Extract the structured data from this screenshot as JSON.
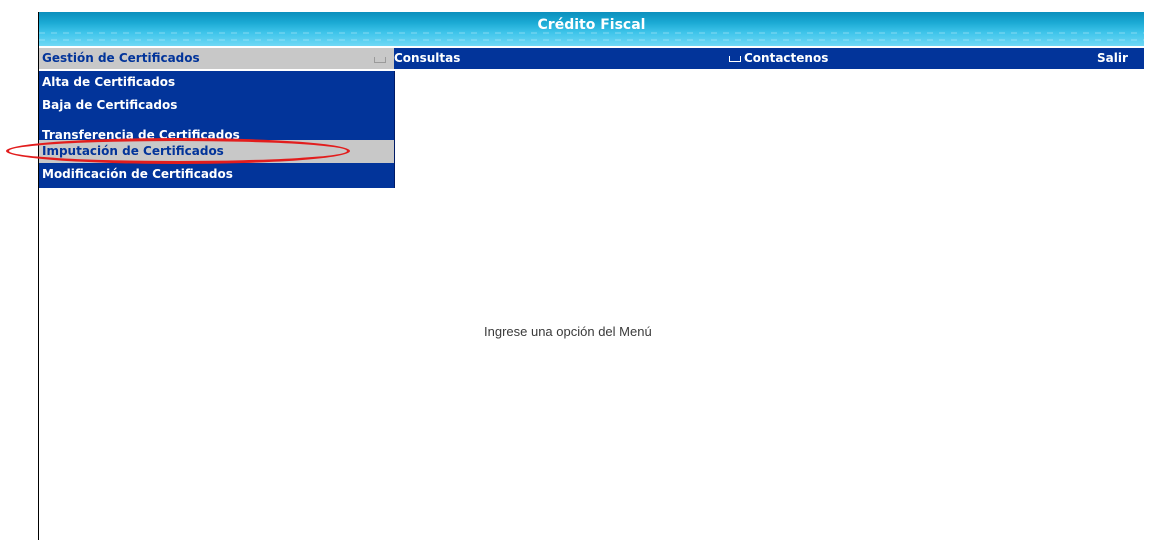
{
  "app": {
    "title": "Crédito Fiscal"
  },
  "menu": {
    "items": [
      {
        "label": "Gestión de Certificados"
      },
      {
        "label": "Consultas"
      },
      {
        "label": "Contactenos"
      },
      {
        "label": "Salir"
      }
    ],
    "dropdown": [
      {
        "label": "Alta de Certificados"
      },
      {
        "label": "Baja de Certificados"
      },
      {
        "label": "Transferencia de Certificados"
      },
      {
        "label": "Imputación de Certificados"
      },
      {
        "label": "Modificación de Certificados"
      }
    ]
  },
  "main": {
    "message": "Ingrese una opción del Menú"
  },
  "colors": {
    "menu_bg": "#02349a",
    "highlight_bg": "#c8c8c8",
    "title_bar": "#3ec4ea",
    "annotation": "#e21d1d"
  }
}
